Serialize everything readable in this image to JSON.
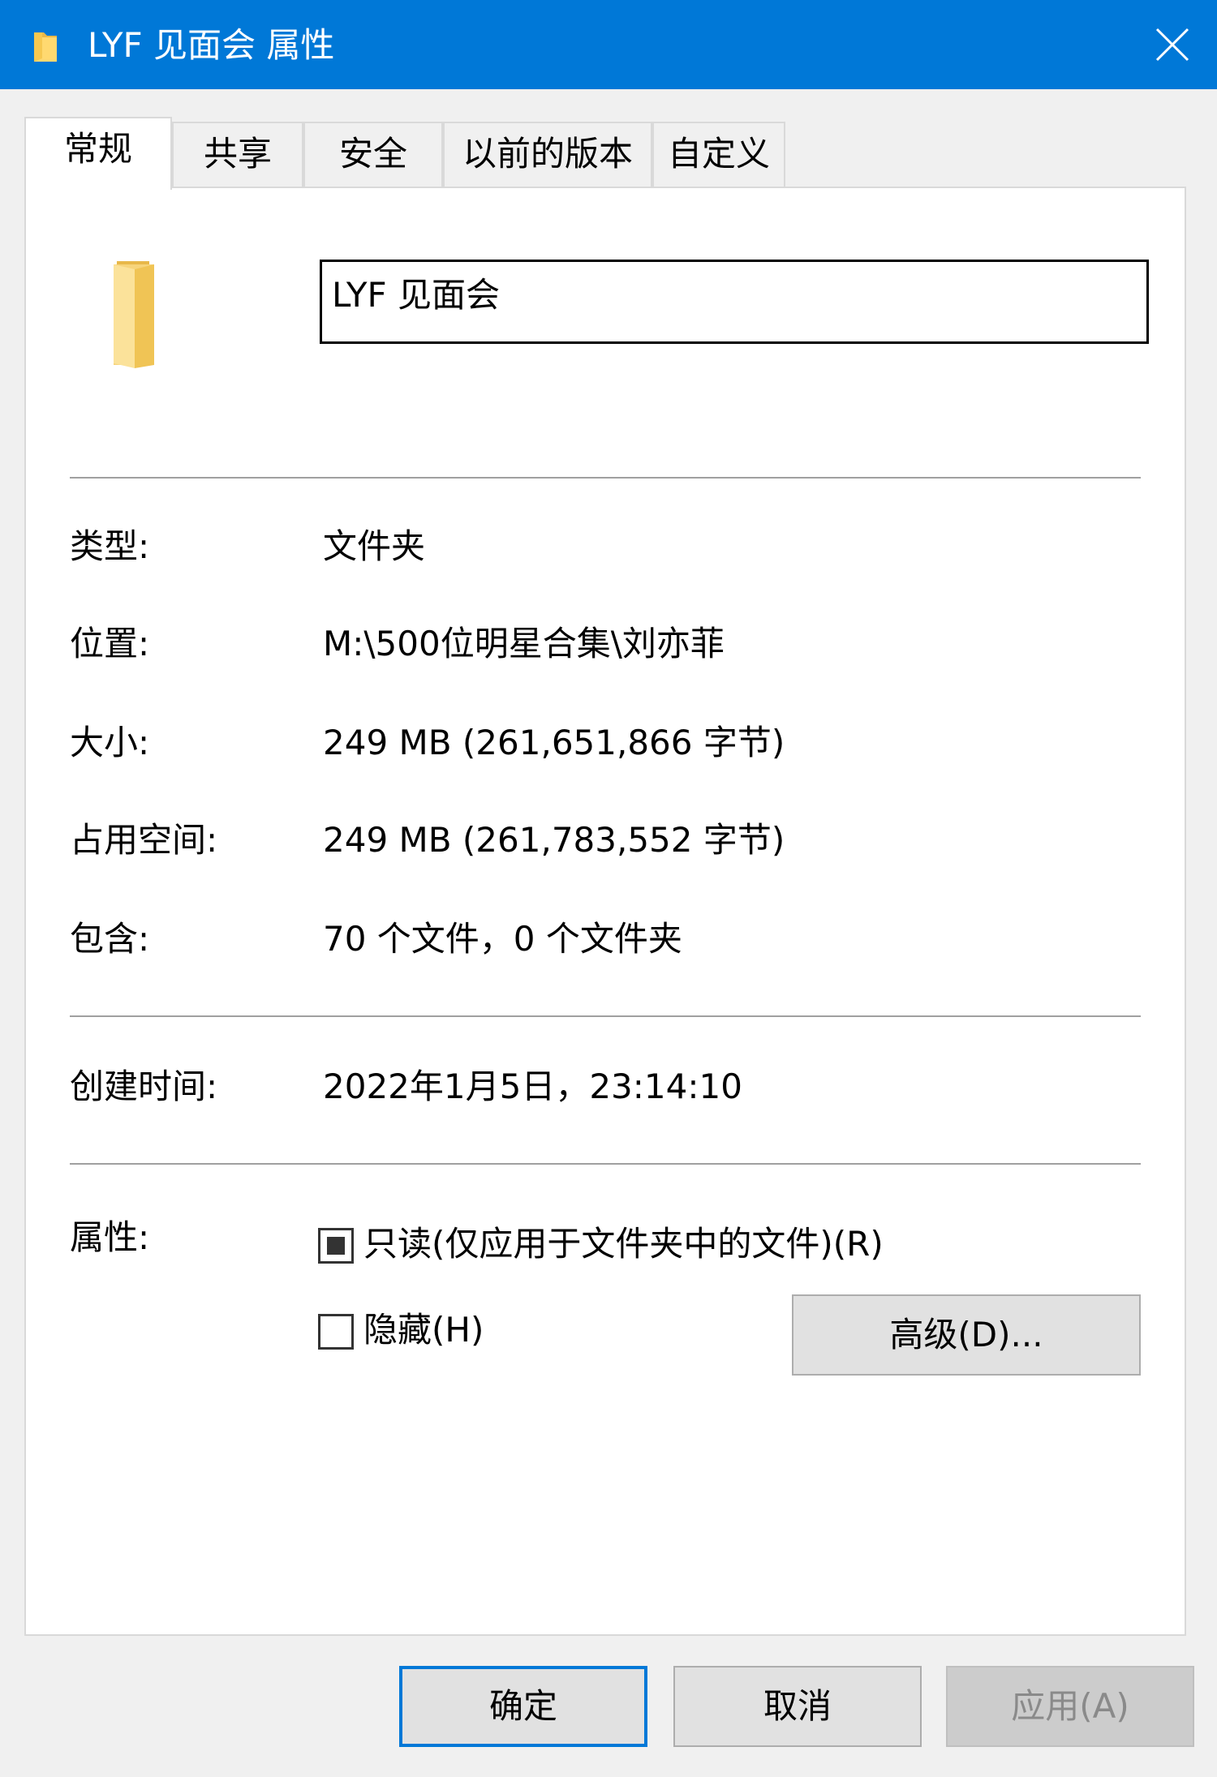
{
  "window": {
    "title": "LYF 见面会 属性",
    "icon": "folder-icon",
    "close_icon": "close-icon",
    "accent_color": "#0078d7"
  },
  "tabs": [
    {
      "label": "常规",
      "active": true
    },
    {
      "label": "共享",
      "active": false
    },
    {
      "label": "安全",
      "active": false
    },
    {
      "label": "以前的版本",
      "active": false
    },
    {
      "label": "自定义",
      "active": false
    }
  ],
  "general": {
    "name_value": "LYF 见面会",
    "fields": [
      {
        "label": "类型:",
        "value": "文件夹"
      },
      {
        "label": "位置:",
        "value": "M:\\500位明星合集\\刘亦菲"
      },
      {
        "label": "大小:",
        "value": "249 MB (261,651,866 字节)"
      },
      {
        "label": "占用空间:",
        "value": "249 MB (261,783,552 字节)"
      },
      {
        "label": "包含:",
        "value": "70 个文件，0 个文件夹"
      }
    ],
    "created": {
      "label": "创建时间:",
      "value": "2022年1月5日，23:14:10"
    },
    "attributes": {
      "label": "属性:",
      "readonly": {
        "label": "只读(仅应用于文件夹中的文件)(R)",
        "state": "indeterminate"
      },
      "hidden": {
        "label": "隐藏(H)",
        "state": "unchecked"
      },
      "advanced_button": "高级(D)..."
    }
  },
  "footer": {
    "ok": "确定",
    "cancel": "取消",
    "apply": "应用(A)",
    "apply_enabled": false
  }
}
